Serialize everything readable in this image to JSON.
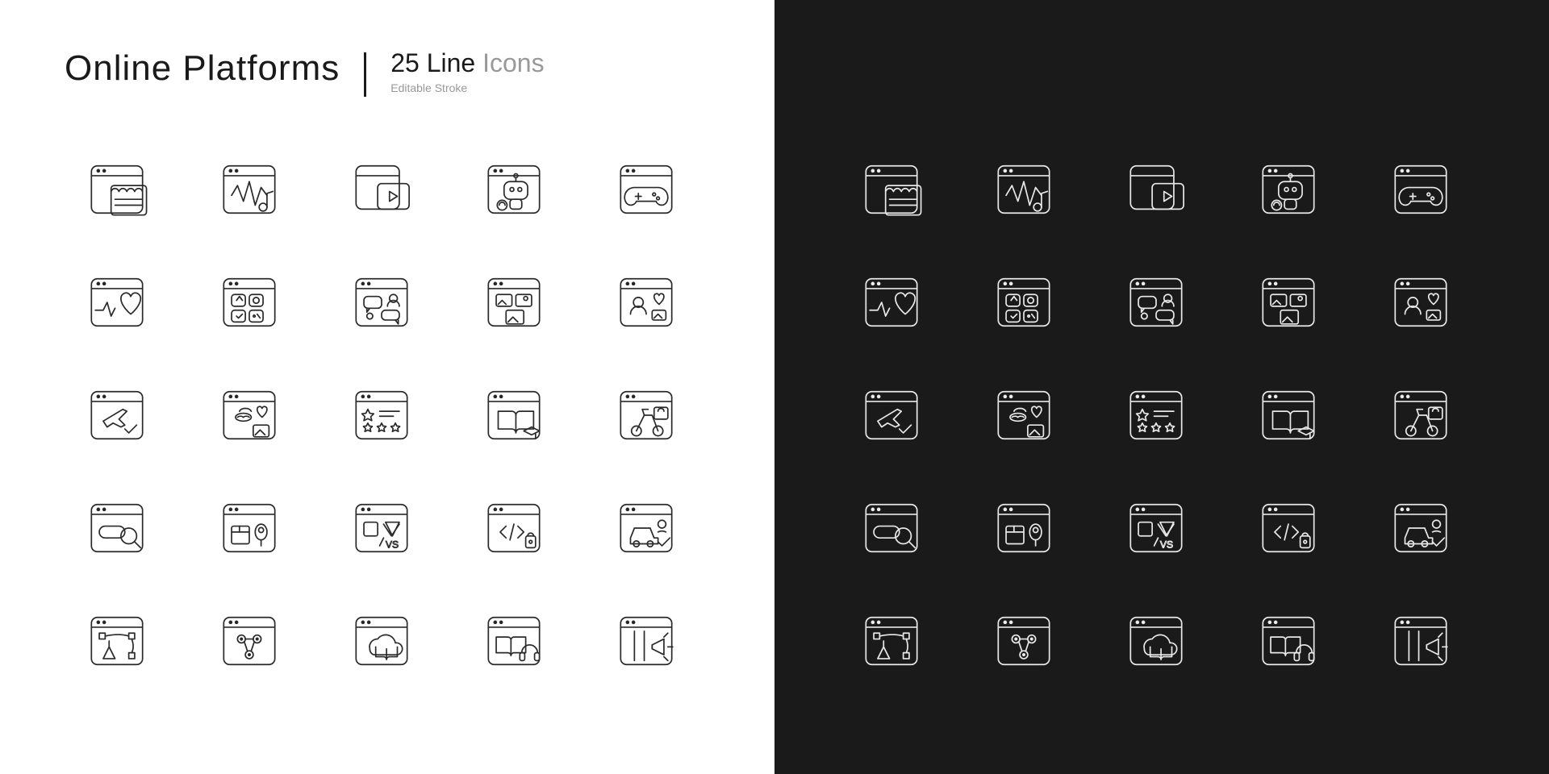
{
  "header": {
    "title": "Online Platforms",
    "count": "25",
    "unit": "Line",
    "suffix": "Icons",
    "tagline": "Editable Stroke"
  },
  "icons": [
    "online-store",
    "music-audio",
    "video-streaming",
    "ai-chatbot",
    "gaming",
    "health-heart",
    "app-store",
    "community-chat",
    "photo-gallery",
    "social-profile",
    "travel-booking",
    "anonymous-dating",
    "reviews-rating",
    "education-learning",
    "food-delivery",
    "search-engine",
    "package-tracking",
    "comparison-vs",
    "open-source-code",
    "ride-sharing",
    "design-vector",
    "team-network",
    "cloud-library",
    "audiobook",
    "digital-marketing"
  ]
}
